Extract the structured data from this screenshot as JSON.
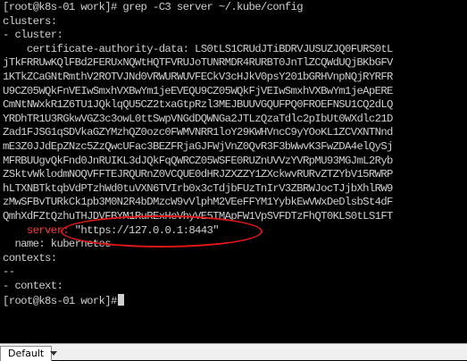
{
  "terminal": {
    "lines": [
      "[root@k8s-01 work]# grep -C3 server ~/.kube/config",
      "clusters:",
      "- cluster:",
      "    certificate-authority-data: LS0tLS1CRUdJTiBDRVJUSUZJQ0FURS0tL",
      "jTkFRRUwKQlFBd2FERUxNQWtHQTFVRUJoTUNRMDR4RURBT0JnTlZCQWdUQjBKbGFV",
      "1KTkZCaGNtRmthV2ROTVJNd0VRWURWUVFECkV3cHJkV0psY201bGRHVnpNQjRYRFR",
      "U9CZ05WQkFnVEIwSmxhVXBwYm1jeEVEQU9CZ05WQkFjVEIwSmxhVXBwYm1jeApERE",
      "CmNtNWxkR1Z6TU1JQklqQU5CZ2txaGtpRzl3MEJBUUVGQUFPQ0FROEFNSU1CQ2dLQ",
      "YRDhTR1U3RGkwVGZ3c3owL0ttSwpVNGdDQWNGa2JTLzQzaTdlc2pIbUt0WXdlc21D",
      "Zad1FJSG1qSDVkaGZYMzhQZ0ozc0FWMVNRR1loY29KWHVncC9yYOoKL1ZCVXNTNnd",
      "mE3Z0JJdEpZNzc5ZzQwcUFac3BEZFRjaGJFWjVnZ0QvR3F3bWwvK3FwZDA4elQySj",
      "MFRBUUgvQkFnd0JnRUIKL3dJQkFqQWRCZ05WSFE0RUZnUVVzYVRpMU93MGJmL2Ryb",
      "ZSktvWklodmNOQVFFTEJRQURnZ0VCQUE0dHRJZXZZY1ZXckwvRURvZTZYbV15RWRP",
      "hLTXNBTktqbVdPTzhWd0tuVXN6TVIrb0x3cTdjbFUzTnIrV3ZBRWJocTJjbXhlRW9",
      "zMwSFBvTURkCk1pb3M0N2R4bDMzcW9vVlphM2VEeFFYM1YybkEwVWxDeDlsbSt4dF",
      "QmhXdFZtQzhuTHJDVFBYM1RuRExHeVhyVE5TMApFW1VpSVFDTzFhQT0KLS0tLS1FT"
    ],
    "server_key": "server:",
    "server_value": "\"https://127.0.0.1:8443\"",
    "name_line": "  name: kubernetes",
    "contexts_line": "contexts:",
    "separator_line": "--",
    "context_line": "- context:",
    "final_prompt": "[root@k8s-01 work]#"
  },
  "tab": {
    "label": "Default"
  },
  "colors": {
    "background": "#000000",
    "foreground": "#cfcfcf",
    "highlight_keyword": "#ff3b3b",
    "annotation": "#e31616"
  },
  "icons": {
    "tab_dropdown": "chevron-down-icon"
  }
}
